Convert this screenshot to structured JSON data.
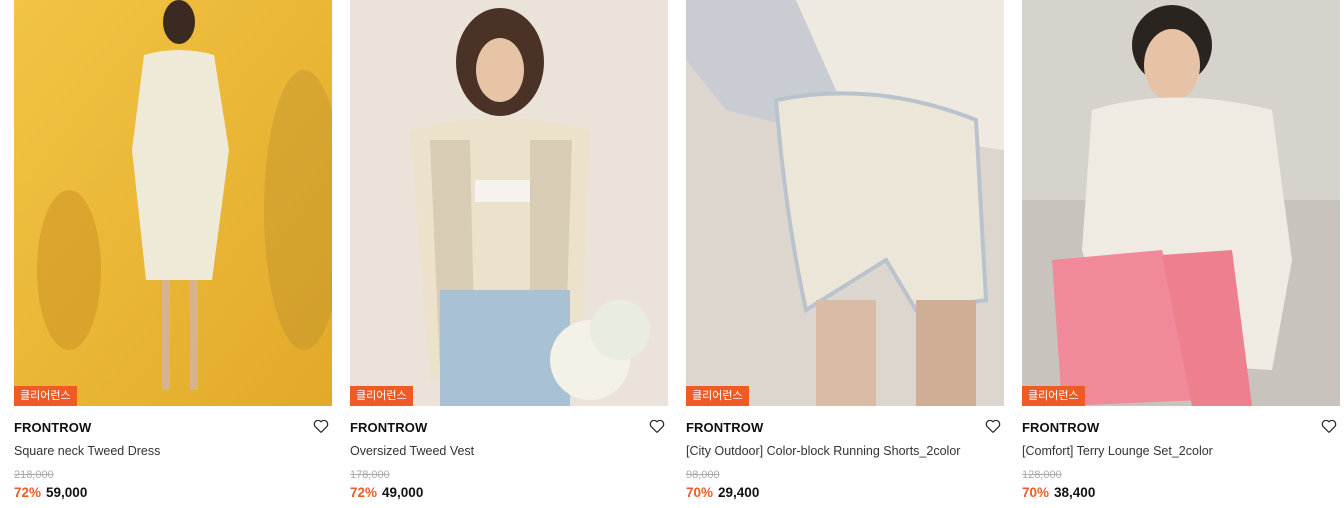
{
  "products": [
    {
      "badge": "클리어런스",
      "brand": "FRONTROW",
      "name": "Square neck Tweed Dress",
      "original_price": "218,000",
      "discount": "72%",
      "sale_price": "59,000",
      "wishlist_icon": "heart-outline-icon"
    },
    {
      "badge": "클리어런스",
      "brand": "FRONTROW",
      "name": "Oversized Tweed Vest",
      "original_price": "178,000",
      "discount": "72%",
      "sale_price": "49,000",
      "wishlist_icon": "heart-outline-icon"
    },
    {
      "badge": "클리어런스",
      "brand": "FRONTROW",
      "name": "[City Outdoor] Color-block Running Shorts_2color",
      "original_price": "98,000",
      "discount": "70%",
      "sale_price": "29,400",
      "wishlist_icon": "heart-outline-icon"
    },
    {
      "badge": "클리어런스",
      "brand": "FRONTROW",
      "name": "[Comfort] Terry Lounge Set_2color",
      "original_price": "128,000",
      "discount": "70%",
      "sale_price": "38,400",
      "wishlist_icon": "heart-outline-icon"
    }
  ],
  "colors": {
    "accent": "#ef5b25",
    "badge_bg": "#ef5b25",
    "strike_price": "#aaaaaa"
  }
}
